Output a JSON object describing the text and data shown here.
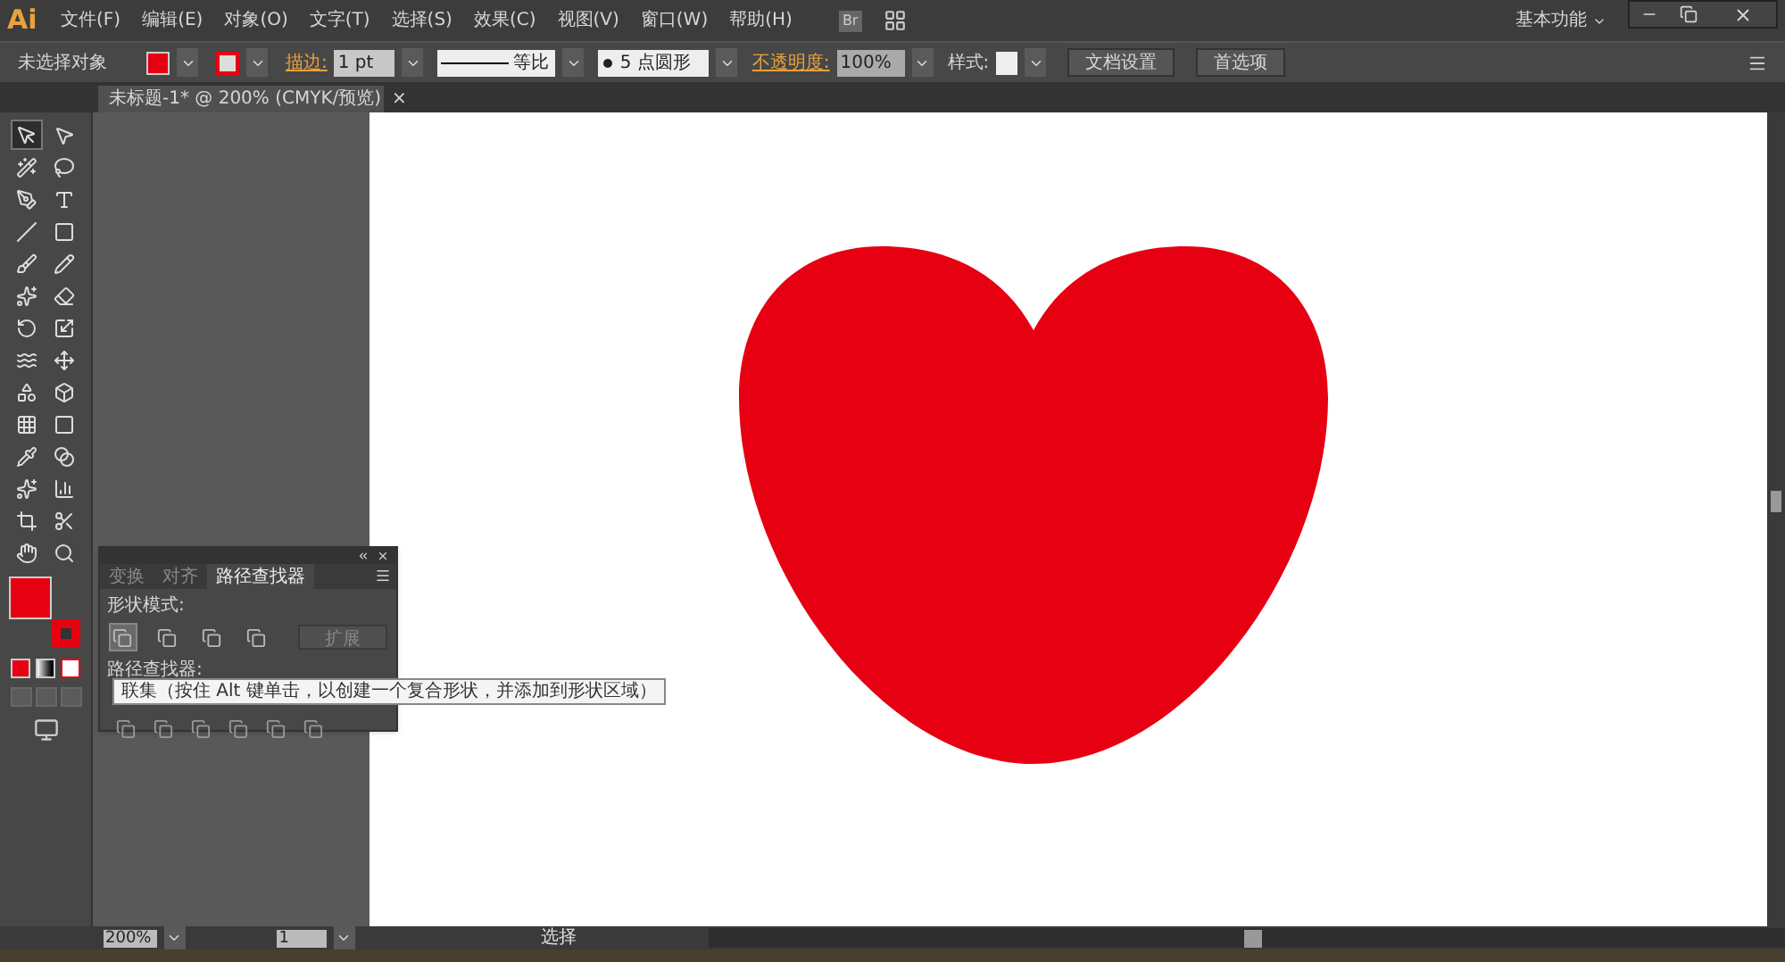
{
  "menu_bar": {
    "logo": "Ai",
    "items": [
      "文件(F)",
      "编辑(E)",
      "对象(O)",
      "文字(T)",
      "选择(S)",
      "效果(C)",
      "视图(V)",
      "窗口(W)",
      "帮助(H)"
    ],
    "bridge": "Br",
    "workspace": "基本功能"
  },
  "control_bar": {
    "selection": "未选择对象",
    "stroke_label": "描边:",
    "stroke_weight": "1 pt",
    "stroke_profile": "等比",
    "brush": "5 点圆形",
    "opacity_label": "不透明度:",
    "opacity": "100%",
    "style_label": "样式:",
    "buttons": [
      "文档设置",
      "首选项"
    ]
  },
  "document_tab": {
    "title": "未标题-1* @ 200% (CMYK/预览)",
    "close": "×"
  },
  "tools": [
    {
      "kind": "select",
      "selected": true
    },
    {
      "kind": "direct",
      "selected": false
    },
    {
      "kind": "wand",
      "selected": false
    },
    {
      "kind": "lasso",
      "selected": false
    },
    {
      "kind": "pen",
      "selected": false
    },
    {
      "kind": "type",
      "selected": false
    },
    {
      "kind": "line",
      "selected": false
    },
    {
      "kind": "rect",
      "selected": false
    },
    {
      "kind": "brush",
      "selected": false
    },
    {
      "kind": "pencil",
      "selected": false
    },
    {
      "kind": "blob",
      "selected": false
    },
    {
      "kind": "eraser",
      "selected": false
    },
    {
      "kind": "rotate",
      "selected": false
    },
    {
      "kind": "scale",
      "selected": false
    },
    {
      "kind": "warp",
      "selected": false
    },
    {
      "kind": "transform",
      "selected": false
    },
    {
      "kind": "builder",
      "selected": false
    },
    {
      "kind": "perspective",
      "selected": false
    },
    {
      "kind": "mesh",
      "selected": false
    },
    {
      "kind": "gradient",
      "selected": false
    },
    {
      "kind": "eyedropper",
      "selected": false
    },
    {
      "kind": "blend",
      "selected": false
    },
    {
      "kind": "sprayer",
      "selected": false
    },
    {
      "kind": "graph",
      "selected": false
    },
    {
      "kind": "artboard",
      "selected": false
    },
    {
      "kind": "slice",
      "selected": false
    },
    {
      "kind": "hand",
      "selected": false
    },
    {
      "kind": "zoom",
      "selected": false
    }
  ],
  "panel": {
    "tabs": [
      {
        "label": "变换",
        "selected": false
      },
      {
        "label": "对齐",
        "selected": false
      },
      {
        "label": "路径查找器",
        "selected": true
      }
    ],
    "shape_modes_label": "形状模式:",
    "expand_button": "扩展",
    "pathfinders_label": "路径查找器:"
  },
  "tooltip": "联集（按住 Alt 键单击，以创建一个复合形状，并添加到形状区域）",
  "status_bar": {
    "zoom": "200%",
    "page": "1",
    "tool": "选择"
  }
}
